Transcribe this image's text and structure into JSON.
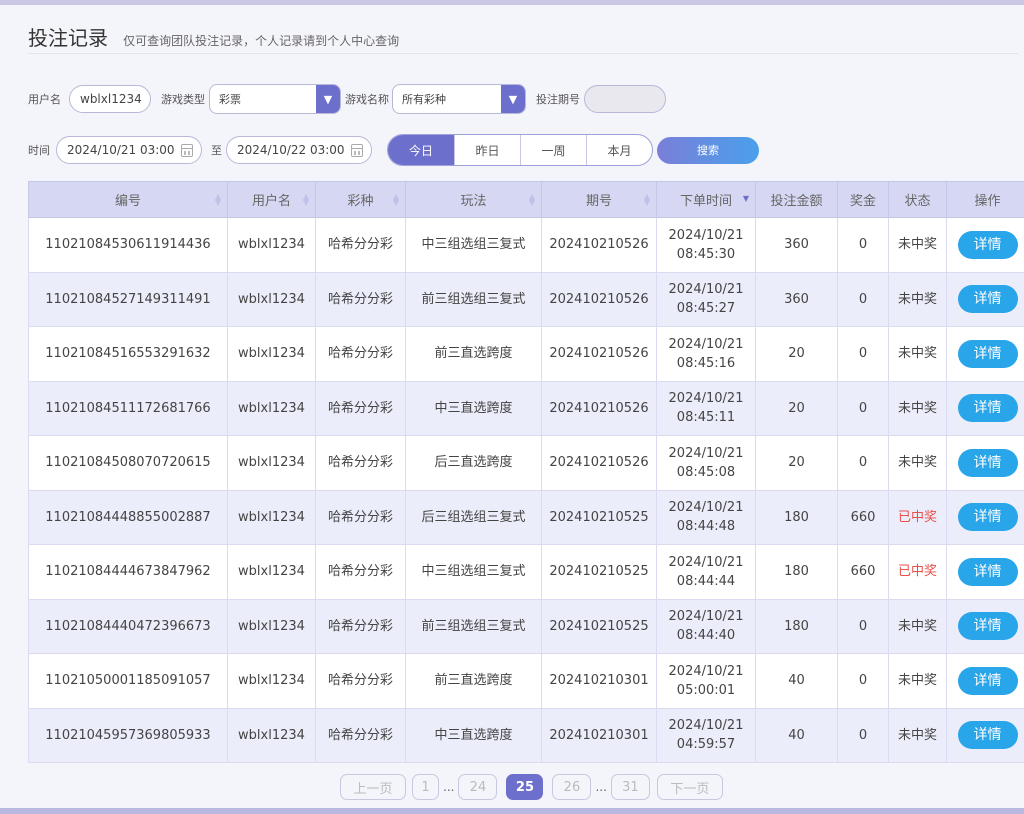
{
  "header": {
    "title": "投注记录",
    "subtitle": "仅可查询团队投注记录，个人记录请到个人中心查询"
  },
  "filters": {
    "username_label": "用户名",
    "username_value": "wblxl1234",
    "game_type_label": "游戏类型",
    "game_type_value": "彩票",
    "game_name_label": "游戏名称",
    "game_name_value": "所有彩种",
    "period_label": "投注期号",
    "period_value": "",
    "time_label": "时间",
    "time_from": "2024/10/21 03:00",
    "to_label": "至",
    "time_to": "2024/10/22 03:00",
    "ranges": [
      "今日",
      "昨日",
      "一周",
      "本月"
    ],
    "search_label": "搜索"
  },
  "table": {
    "columns": [
      "编号",
      "用户名",
      "彩种",
      "玩法",
      "期号",
      "下单时间",
      "投注金额",
      "奖金",
      "状态",
      "操作"
    ],
    "rows": [
      {
        "id": "11021084530611914436",
        "user": "wblxl1234",
        "lottery": "哈希分分彩",
        "play": "中三组选组三复式",
        "period": "202410210526",
        "date": "2024/10/21",
        "time": "08:45:30",
        "amount": "360",
        "prize": "0",
        "status": "未中奖",
        "action": "详情"
      },
      {
        "id": "11021084527149311491",
        "user": "wblxl1234",
        "lottery": "哈希分分彩",
        "play": "前三组选组三复式",
        "period": "202410210526",
        "date": "2024/10/21",
        "time": "08:45:27",
        "amount": "360",
        "prize": "0",
        "status": "未中奖",
        "action": "详情"
      },
      {
        "id": "11021084516553291632",
        "user": "wblxl1234",
        "lottery": "哈希分分彩",
        "play": "前三直选跨度",
        "period": "202410210526",
        "date": "2024/10/21",
        "time": "08:45:16",
        "amount": "20",
        "prize": "0",
        "status": "未中奖",
        "action": "详情"
      },
      {
        "id": "11021084511172681766",
        "user": "wblxl1234",
        "lottery": "哈希分分彩",
        "play": "中三直选跨度",
        "period": "202410210526",
        "date": "2024/10/21",
        "time": "08:45:11",
        "amount": "20",
        "prize": "0",
        "status": "未中奖",
        "action": "详情"
      },
      {
        "id": "11021084508070720615",
        "user": "wblxl1234",
        "lottery": "哈希分分彩",
        "play": "后三直选跨度",
        "period": "202410210526",
        "date": "2024/10/21",
        "time": "08:45:08",
        "amount": "20",
        "prize": "0",
        "status": "未中奖",
        "action": "详情"
      },
      {
        "id": "11021084448855002887",
        "user": "wblxl1234",
        "lottery": "哈希分分彩",
        "play": "后三组选组三复式",
        "period": "202410210525",
        "date": "2024/10/21",
        "time": "08:44:48",
        "amount": "180",
        "prize": "660",
        "status": "已中奖",
        "action": "详情"
      },
      {
        "id": "11021084444673847962",
        "user": "wblxl1234",
        "lottery": "哈希分分彩",
        "play": "中三组选组三复式",
        "period": "202410210525",
        "date": "2024/10/21",
        "time": "08:44:44",
        "amount": "180",
        "prize": "660",
        "status": "已中奖",
        "action": "详情"
      },
      {
        "id": "11021084440472396673",
        "user": "wblxl1234",
        "lottery": "哈希分分彩",
        "play": "前三组选组三复式",
        "period": "202410210525",
        "date": "2024/10/21",
        "time": "08:44:40",
        "amount": "180",
        "prize": "0",
        "status": "未中奖",
        "action": "详情"
      },
      {
        "id": "11021050001185091057",
        "user": "wblxl1234",
        "lottery": "哈希分分彩",
        "play": "前三直选跨度",
        "period": "202410210301",
        "date": "2024/10/21",
        "time": "05:00:01",
        "amount": "40",
        "prize": "0",
        "status": "未中奖",
        "action": "详情"
      },
      {
        "id": "11021045957369805933",
        "user": "wblxl1234",
        "lottery": "哈希分分彩",
        "play": "中三直选跨度",
        "period": "202410210301",
        "date": "2024/10/21",
        "time": "04:59:57",
        "amount": "40",
        "prize": "0",
        "status": "未中奖",
        "action": "详情"
      }
    ]
  },
  "pagination": {
    "prev": "上一页",
    "next": "下一页",
    "pages": [
      "1",
      "24",
      "25",
      "26",
      "31"
    ],
    "current": "25"
  },
  "colors": {
    "accent": "#6c70cc",
    "detail_button": "#29a5ea",
    "won_text": "#e8504a"
  }
}
